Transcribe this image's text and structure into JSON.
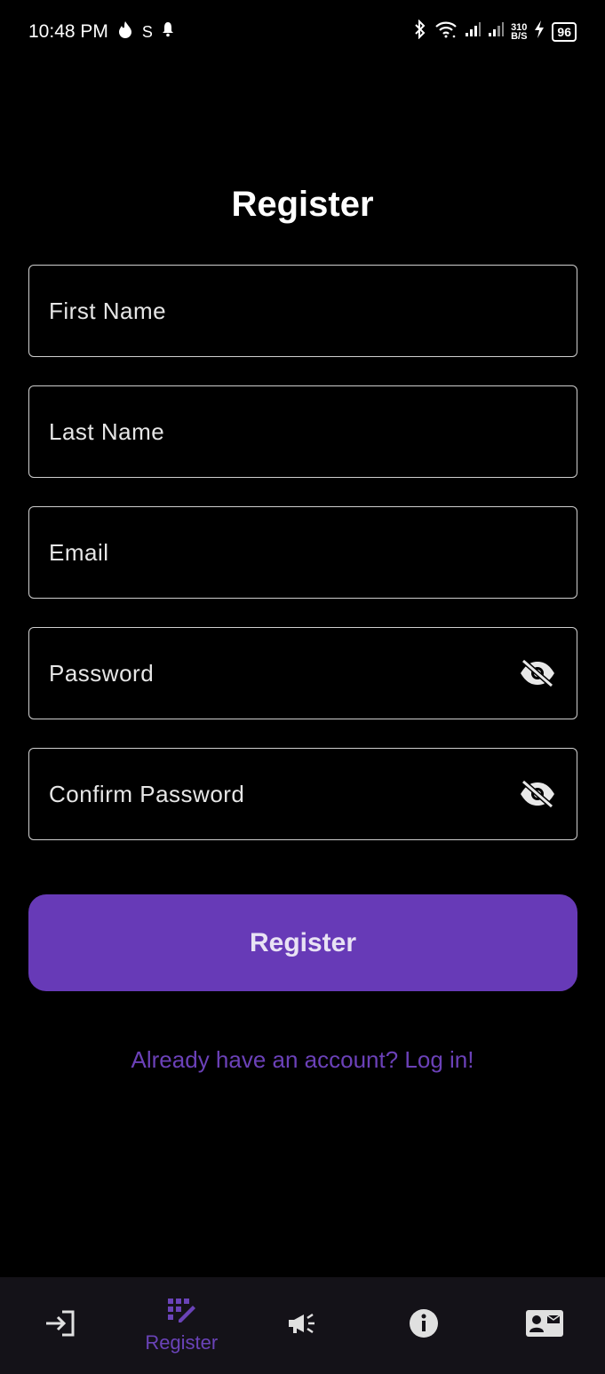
{
  "status_bar": {
    "time": "10:48 PM",
    "speed_top": "310",
    "speed_bottom": "B/S",
    "battery": "96"
  },
  "page": {
    "title": "Register"
  },
  "form": {
    "first_name_label": "First Name",
    "last_name_label": "Last Name",
    "email_label": "Email",
    "password_label": "Password",
    "confirm_password_label": "Confirm Password",
    "submit_label": "Register",
    "login_link": "Already have an account? Log in!"
  },
  "bottom_nav": {
    "items": [
      {
        "icon": "login-icon",
        "label": ""
      },
      {
        "icon": "register-icon",
        "label": "Register",
        "active": true
      },
      {
        "icon": "campaign-icon",
        "label": ""
      },
      {
        "icon": "info-icon",
        "label": ""
      },
      {
        "icon": "contact-card-icon",
        "label": ""
      }
    ]
  },
  "colors": {
    "accent": "#673ab7",
    "link": "#6b41b8",
    "background": "#000000",
    "nav_background": "#141218"
  }
}
